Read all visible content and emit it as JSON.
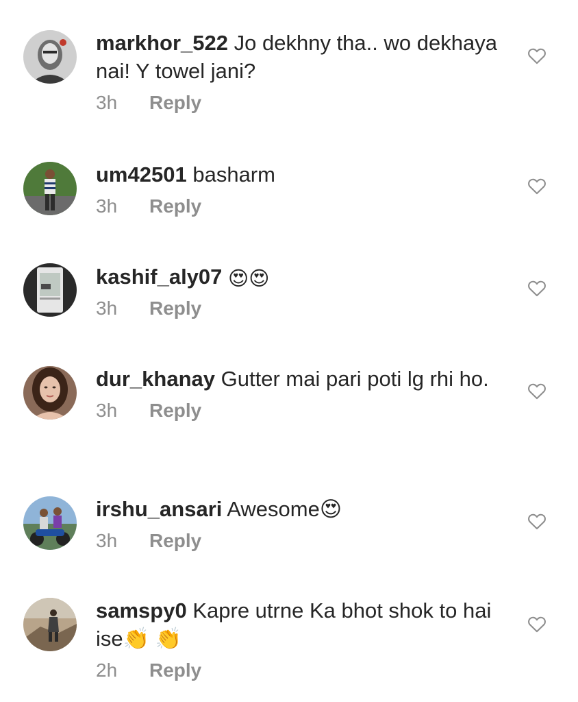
{
  "comments": [
    {
      "username": "markhor_522",
      "text": "Jo dekhny tha.. wo dekhaya nai! Y towel jani?",
      "time": "3h",
      "reply": "Reply",
      "avatar": "man-face-avatar"
    },
    {
      "username": "um42501",
      "text": "basharm",
      "time": "3h",
      "reply": "Reply",
      "avatar": "outdoor-person-avatar"
    },
    {
      "username": "kashif_aly07",
      "text": "😍😍",
      "time": "3h",
      "reply": "Reply",
      "avatar": "phone-photo-avatar"
    },
    {
      "username": "dur_khanay",
      "text": "Gutter mai pari poti lg rhi ho.",
      "time": "3h",
      "reply": "Reply",
      "avatar": "woman-avatar"
    },
    {
      "username": "irshu_ansari",
      "text": "Awesome😍",
      "time": "3h",
      "reply": "Reply",
      "avatar": "motorbike-avatar"
    },
    {
      "username": "samspy0",
      "text": "Kapre utrne Ka bhot shok to hai ise👏 👏",
      "time": "2h",
      "reply": "Reply",
      "avatar": "rock-landscape-avatar"
    }
  ],
  "colors": {
    "text": "#262626",
    "muted": "#8e8e8e",
    "icon": "#8e8e8e"
  },
  "icons": {
    "like": "heart-outline-icon"
  }
}
